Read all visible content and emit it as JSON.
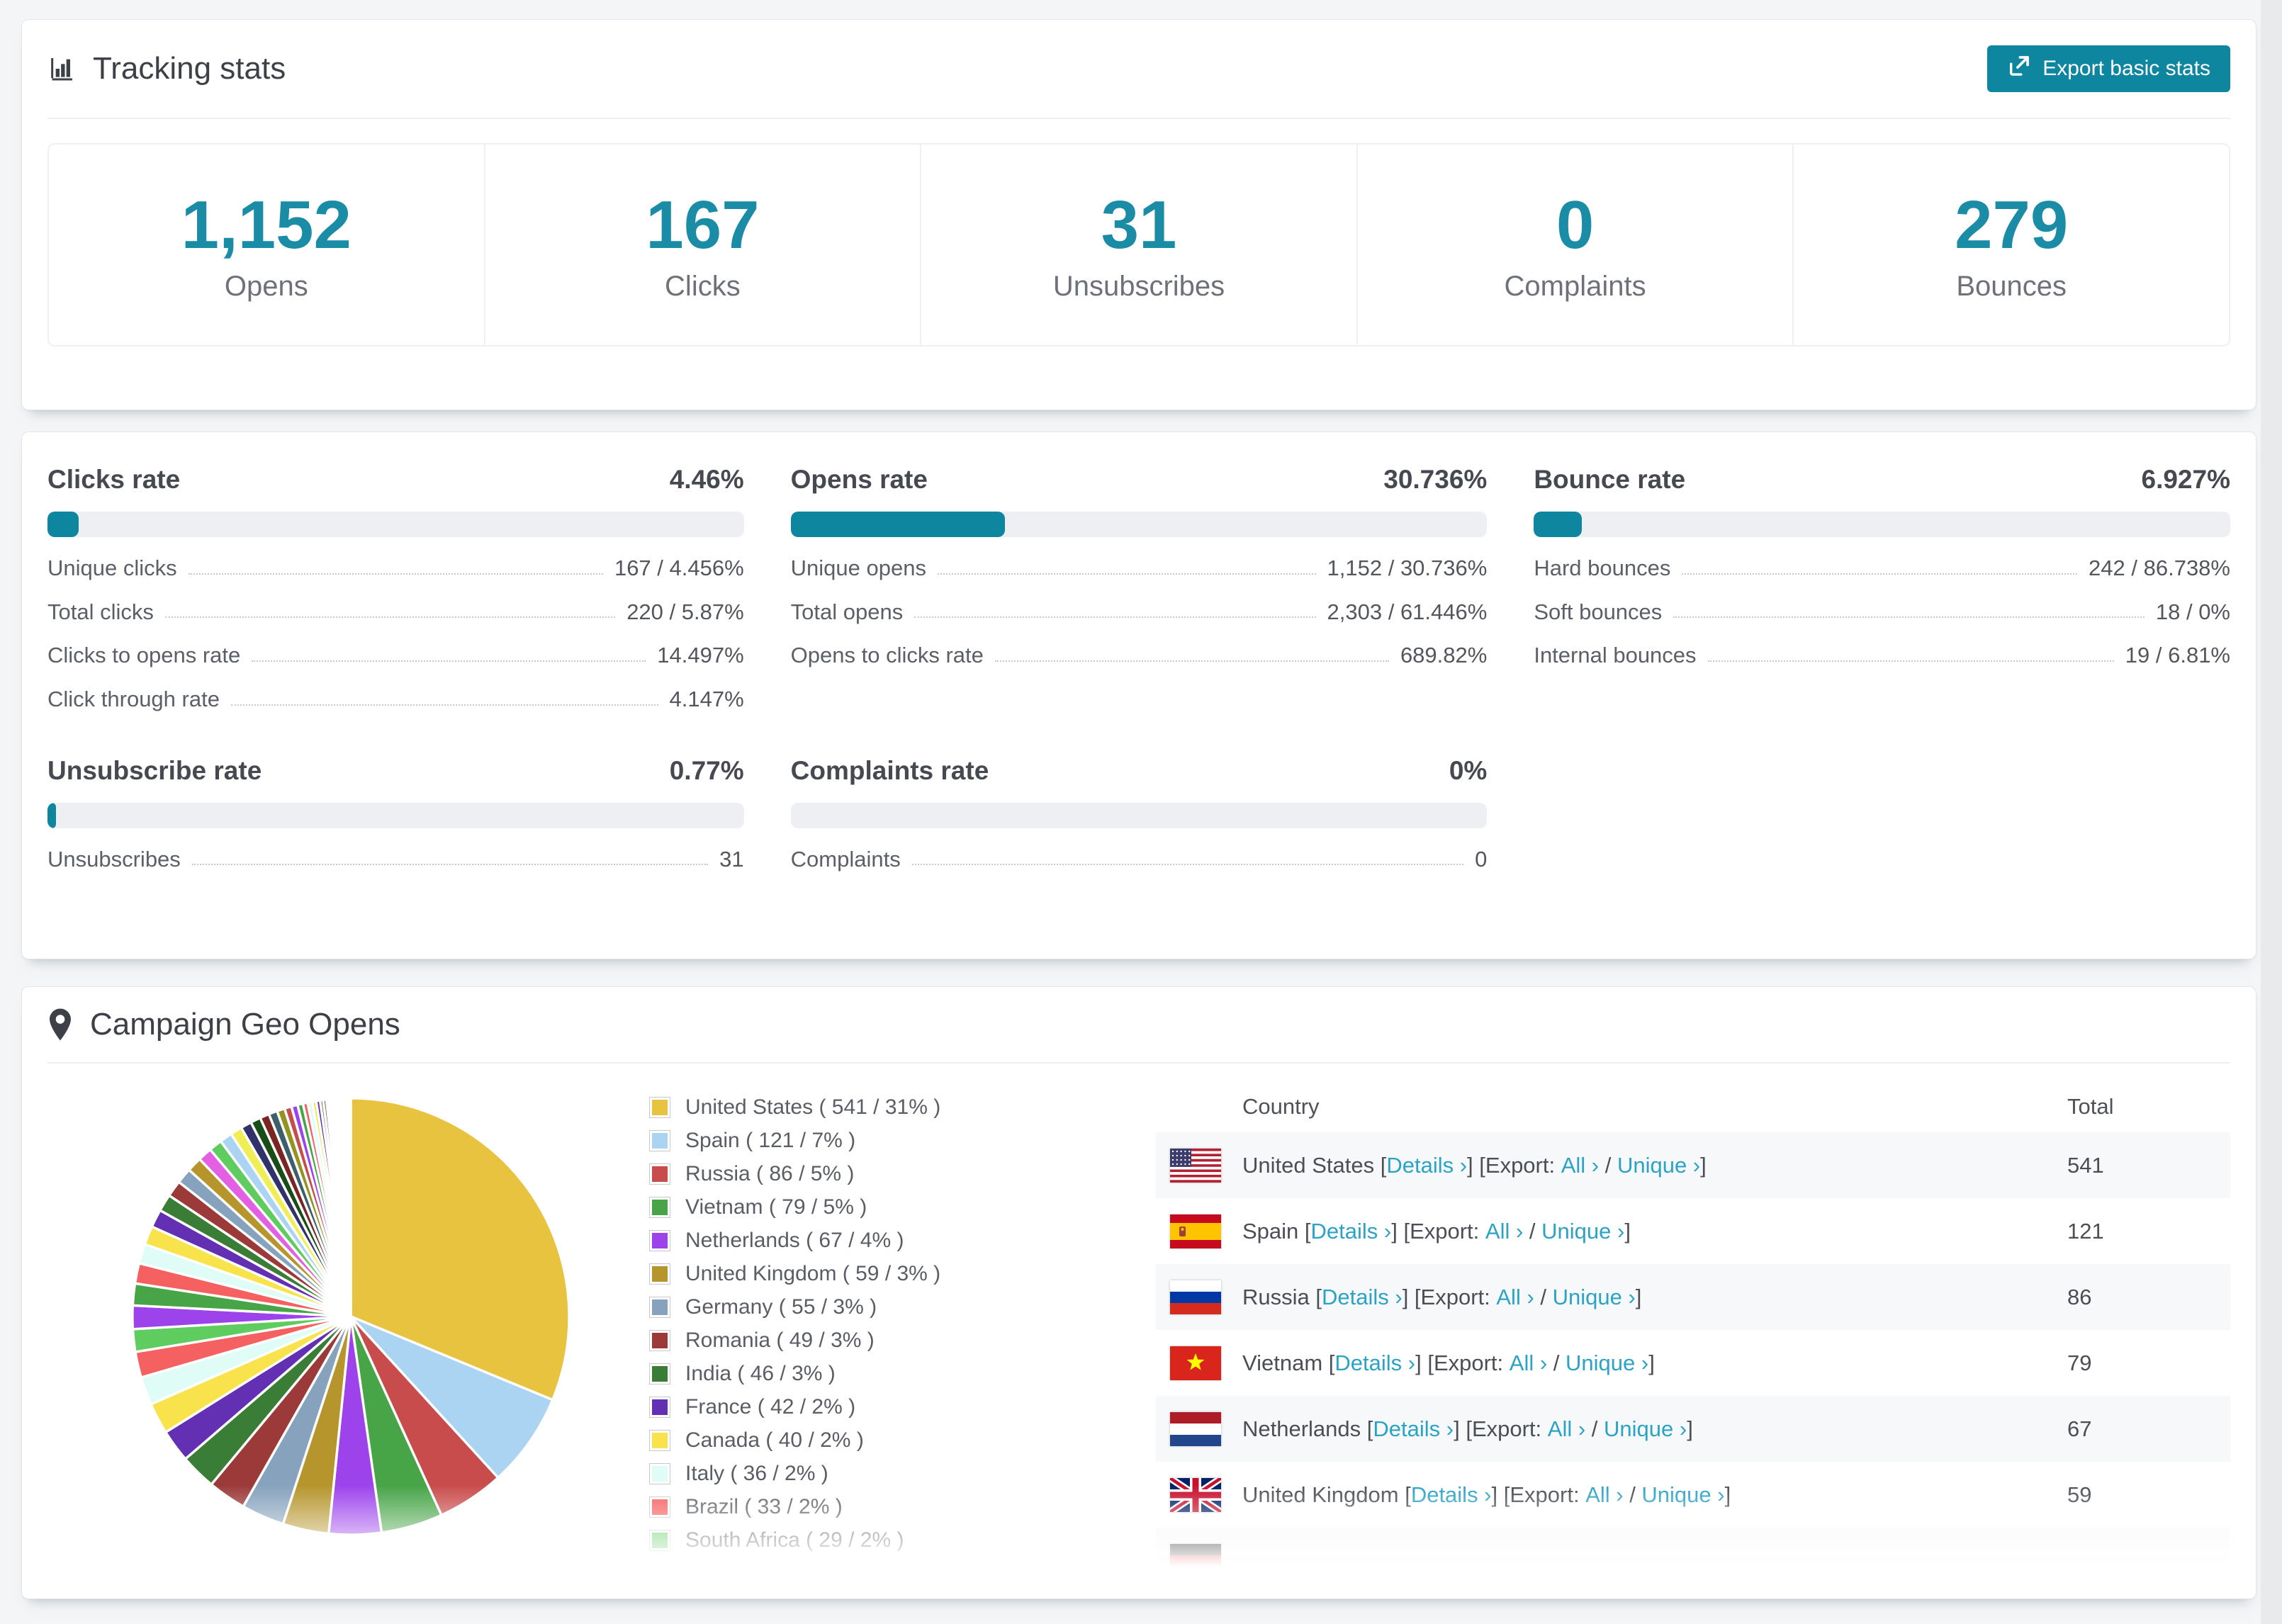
{
  "tracking": {
    "title": "Tracking stats",
    "export_button": "Export basic stats",
    "stats": [
      {
        "label": "Opens",
        "value": "1,152"
      },
      {
        "label": "Clicks",
        "value": "167"
      },
      {
        "label": "Unsubscribes",
        "value": "31"
      },
      {
        "label": "Complaints",
        "value": "0"
      },
      {
        "label": "Bounces",
        "value": "279"
      }
    ]
  },
  "rates": [
    {
      "title": "Clicks rate",
      "value": "4.46%",
      "percent": 4.46,
      "rows": [
        {
          "label": "Unique clicks",
          "value": "167 / 4.456%"
        },
        {
          "label": "Total clicks",
          "value": "220 / 5.87%"
        },
        {
          "label": "Clicks to opens rate",
          "value": "14.497%"
        },
        {
          "label": "Click through rate",
          "value": "4.147%"
        }
      ]
    },
    {
      "title": "Opens rate",
      "value": "30.736%",
      "percent": 30.736,
      "rows": [
        {
          "label": "Unique opens",
          "value": "1,152 / 30.736%"
        },
        {
          "label": "Total opens",
          "value": "2,303 / 61.446%"
        },
        {
          "label": "Opens to clicks rate",
          "value": "689.82%"
        }
      ]
    },
    {
      "title": "Bounce rate",
      "value": "6.927%",
      "percent": 6.927,
      "rows": [
        {
          "label": "Hard bounces",
          "value": "242 / 86.738%"
        },
        {
          "label": "Soft bounces",
          "value": "18 / 0%"
        },
        {
          "label": "Internal bounces",
          "value": "19 / 6.81%"
        }
      ]
    },
    {
      "title": "Unsubscribe rate",
      "value": "0.77%",
      "percent": 0.77,
      "rows": [
        {
          "label": "Unsubscribes",
          "value": "31"
        }
      ]
    },
    {
      "title": "Complaints rate",
      "value": "0%",
      "percent": 0,
      "rows": [
        {
          "label": "Complaints",
          "value": "0"
        }
      ]
    }
  ],
  "geo": {
    "title": "Campaign Geo Opens",
    "links": {
      "details": "Details ›",
      "export_prefix": "Export:",
      "all": "All ›",
      "unique": "Unique ›"
    },
    "table": {
      "headers": [
        "Country",
        "Total"
      ],
      "rows": [
        {
          "country": "United States",
          "flag": "us",
          "total": "541",
          "partial": false
        },
        {
          "country": "Spain",
          "flag": "es",
          "total": "121",
          "partial": false
        },
        {
          "country": "Russia",
          "flag": "ru",
          "total": "86",
          "partial": false
        },
        {
          "country": "Vietnam",
          "flag": "vn",
          "total": "79",
          "partial": false
        },
        {
          "country": "Netherlands",
          "flag": "nl",
          "total": "67",
          "partial": false
        },
        {
          "country": "United Kingdom",
          "flag": "gb",
          "total": "59",
          "partial": false
        },
        {
          "country": "",
          "flag": "de",
          "total": "",
          "partial": true
        }
      ]
    }
  },
  "chart_data": {
    "type": "pie",
    "title": "Campaign Geo Opens",
    "legend_position": "right",
    "start_angle": "top",
    "direction": "clockwise",
    "series": [
      {
        "name": "United States",
        "value": 541,
        "pct": "31%"
      },
      {
        "name": "Spain",
        "value": 121,
        "pct": "7%"
      },
      {
        "name": "Russia",
        "value": 86,
        "pct": "5%"
      },
      {
        "name": "Vietnam",
        "value": 79,
        "pct": "5%"
      },
      {
        "name": "Netherlands",
        "value": 67,
        "pct": "4%"
      },
      {
        "name": "United Kingdom",
        "value": 59,
        "pct": "3%"
      },
      {
        "name": "Germany",
        "value": 55,
        "pct": "3%"
      },
      {
        "name": "Romania",
        "value": 49,
        "pct": "3%"
      },
      {
        "name": "India",
        "value": 46,
        "pct": "3%"
      },
      {
        "name": "France",
        "value": 42,
        "pct": "2%"
      },
      {
        "name": "Canada",
        "value": 40,
        "pct": "2%"
      },
      {
        "name": "Italy",
        "value": 36,
        "pct": "2%"
      },
      {
        "name": "Brazil",
        "value": 33,
        "pct": "2%"
      },
      {
        "name": "South Africa",
        "value": 29,
        "pct": "2%"
      }
    ],
    "colors": [
      "#E8C33F",
      "#ABD3F2",
      "#C94C4C",
      "#47A447",
      "#9C43EC",
      "#B6952C",
      "#86A2BD",
      "#9C3A3A",
      "#3A7D36",
      "#6430B3",
      "#F8E34C",
      "#DFFCF6",
      "#F56060",
      "#5ECC5E"
    ],
    "others_unlabeled_values": [
      30,
      28,
      26,
      25,
      24,
      23,
      22,
      21,
      20,
      19,
      18,
      17,
      16,
      15,
      14,
      13,
      12,
      11,
      10,
      9,
      8,
      7,
      6,
      6,
      5,
      5,
      4,
      4,
      3,
      3,
      3,
      2,
      2,
      2,
      2,
      2,
      1,
      1,
      1,
      1,
      1,
      1,
      1,
      1,
      1,
      1,
      1,
      1
    ],
    "others_color_cycle": [
      "#9C43EC",
      "#47A447",
      "#F56060",
      "#DFFCF6",
      "#F8E34C",
      "#6430B3",
      "#3A7D36",
      "#9C3A3A",
      "#86A2BD",
      "#B6952C",
      "#E35FE3",
      "#5ECC5E",
      "#ABD3F2",
      "#EFEF55",
      "#31316B",
      "#184D18",
      "#7A2424",
      "#3D5F6B",
      "#93931F",
      "#C94C4C"
    ]
  }
}
